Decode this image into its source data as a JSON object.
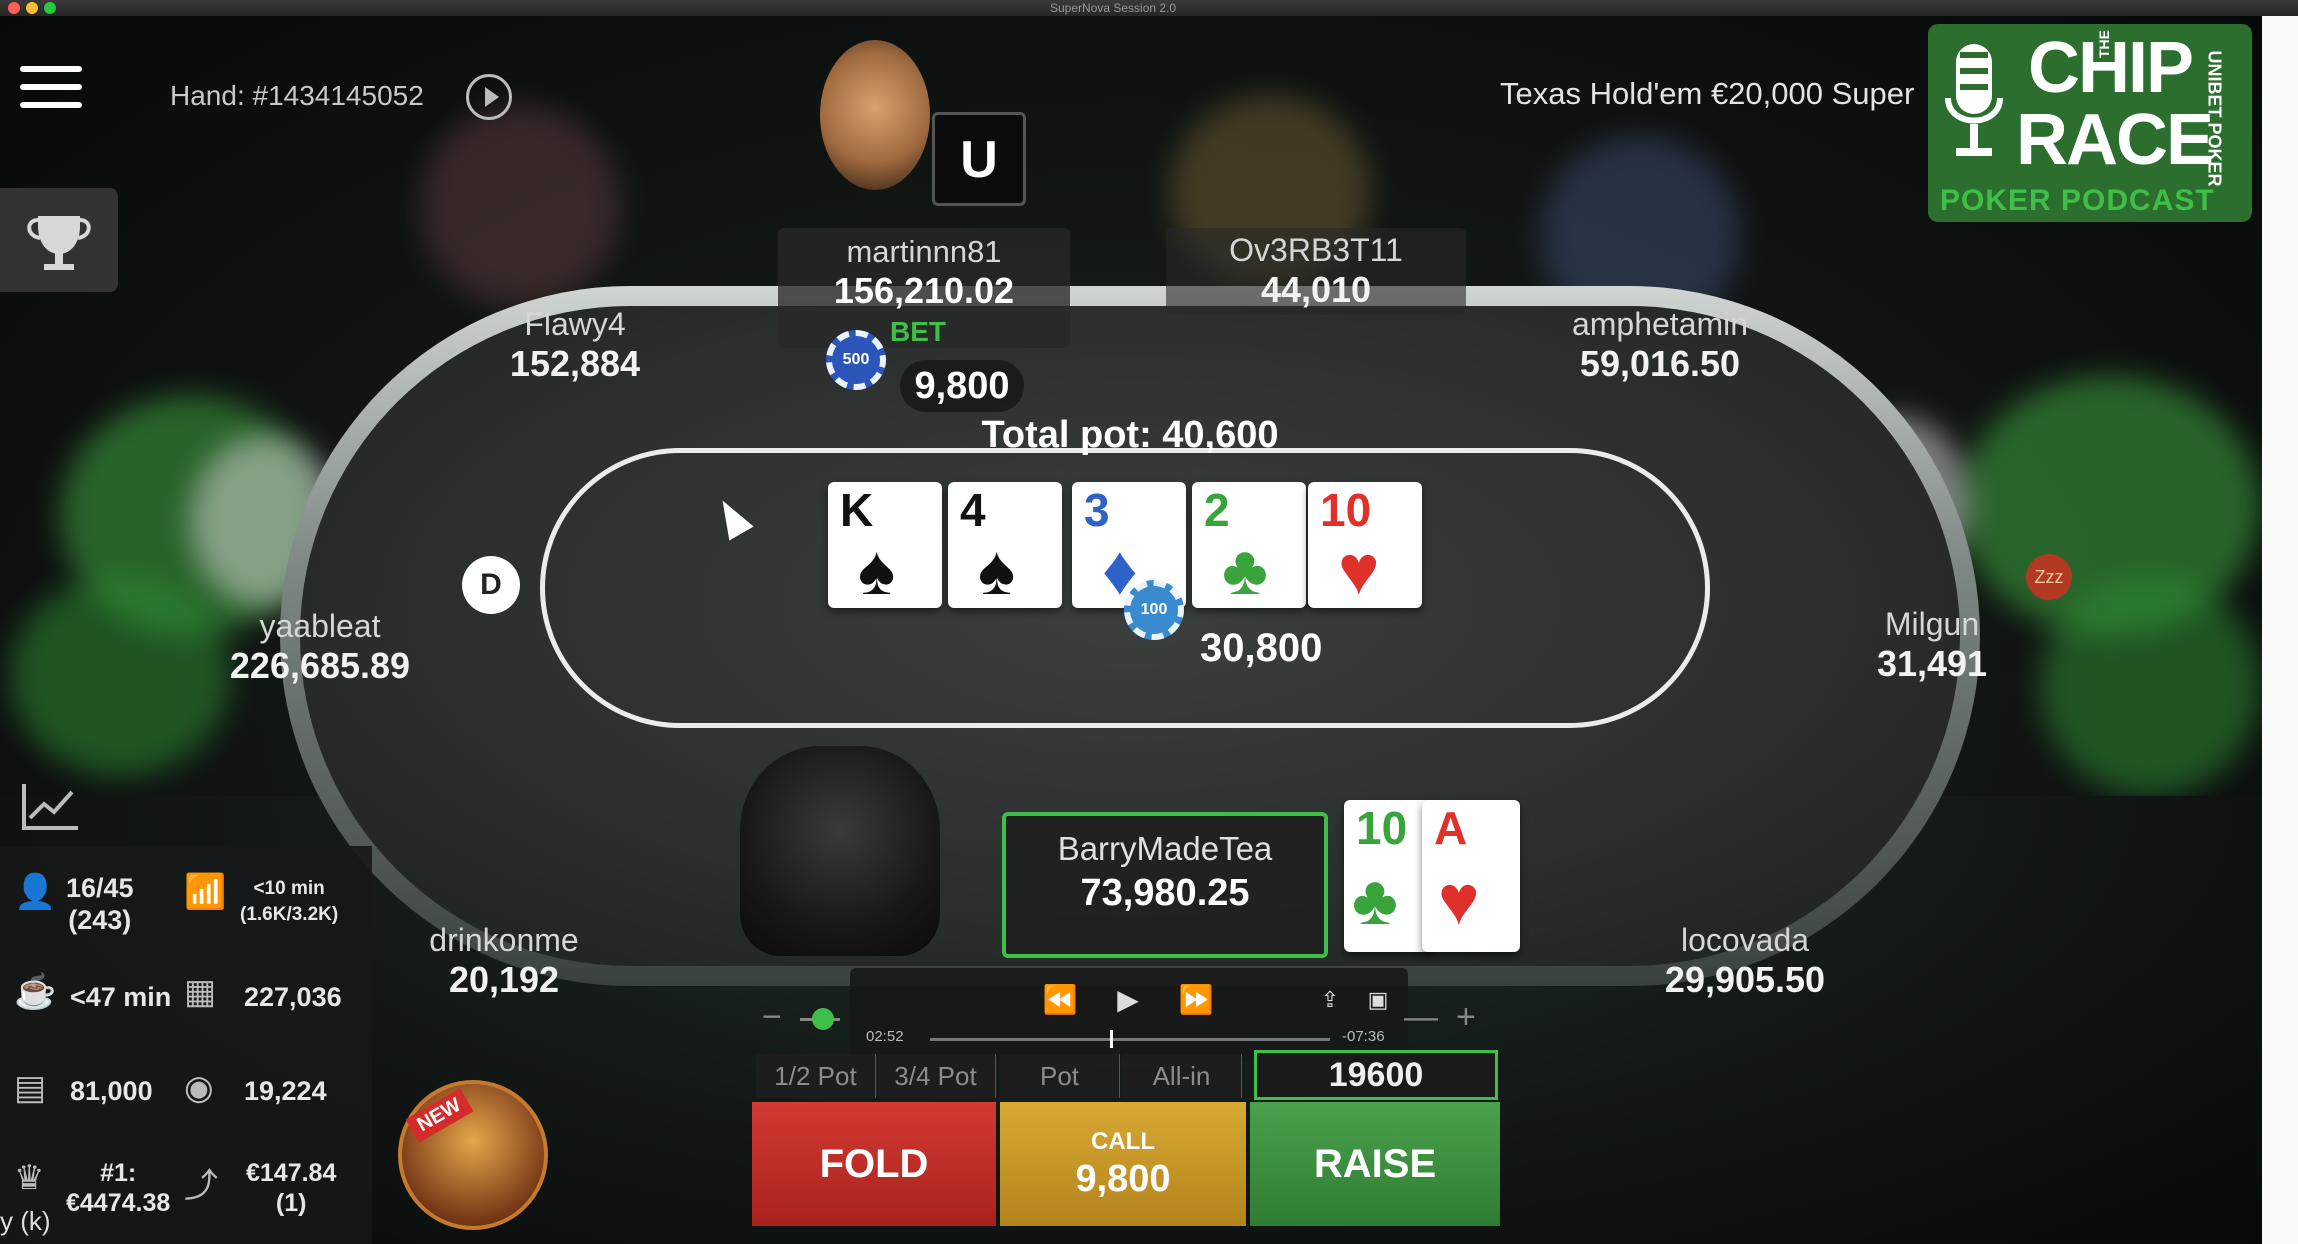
{
  "window": {
    "title": "SuperNova Session 2.0"
  },
  "header": {
    "hand_label": "Hand: #1434145052",
    "game_info": "Texas Hold'em   €20,000 Super"
  },
  "logo": {
    "the": "THE",
    "chip": "CHIP",
    "race": "RACE",
    "subtitle": "POKER PODCAST",
    "side": "UNIBET POKER"
  },
  "players": {
    "martinnn81": {
      "name": "martinnn81",
      "stack": "156,210.02",
      "bet_tag": "BET",
      "bet_amount": "9,800",
      "chip_label": "500"
    },
    "ov3rb3t11": {
      "name": "Ov3RB3T11",
      "stack": "44,010"
    },
    "flawy4": {
      "name": "Flawy4",
      "stack": "152,884"
    },
    "amphetamin": {
      "name": "amphetamin",
      "stack": "59,016.50"
    },
    "yaableat": {
      "name": "yaableat",
      "stack": "226,685.89"
    },
    "milgun": {
      "name": "Milgun",
      "stack": "31,491",
      "sleep_badge": "Zzz"
    },
    "drinkonme": {
      "name": "drinkonme",
      "stack": "20,192"
    },
    "locovada": {
      "name": "locovada",
      "stack": "29,905.50"
    },
    "hero": {
      "name": "BarryMadeTea",
      "stack": "73,980.25"
    }
  },
  "table": {
    "total_pot": "Total pot: 40,600",
    "pot_amount": "30,800",
    "pot_chip_label": "100",
    "dealer": "D",
    "board": [
      {
        "rank": "K",
        "suit": "♠",
        "suit_name": "spade"
      },
      {
        "rank": "4",
        "suit": "♠",
        "suit_name": "spade"
      },
      {
        "rank": "3",
        "suit": "♦",
        "suit_name": "diamond"
      },
      {
        "rank": "2",
        "suit": "♣",
        "suit_name": "club"
      },
      {
        "rank": "10",
        "suit": "♥",
        "suit_name": "heart"
      }
    ],
    "hole_cards": [
      {
        "rank": "10",
        "suit": "♣",
        "suit_name": "club"
      },
      {
        "rank": "A",
        "suit": "♥",
        "suit_name": "heart"
      }
    ]
  },
  "stats": {
    "position": "16/45",
    "position_sub": "(243)",
    "blinds_time": "<10 min",
    "blinds_level": "(1.6K/3.2K)",
    "break": "<47 min",
    "largest_stack": "227,036",
    "average_stack": "81,000",
    "smallest_stack": "19,224",
    "first_prize_label": "#1:",
    "first_prize": "€4474.38",
    "next_prize": "€147.84",
    "next_prize_sub": "(1)"
  },
  "promo": {
    "tag": "NEW"
  },
  "player_bar": {
    "elapsed": "02:52",
    "remaining": "-07:36",
    "progress": 0.45
  },
  "actions": {
    "presets": [
      "1/2 Pot",
      "3/4 Pot",
      "Pot",
      "All-in"
    ],
    "raise_value": "19600",
    "fold": "FOLD",
    "call_label": "CALL",
    "call_amount": "9,800",
    "raise": "RAISE"
  },
  "caption": "y (k)",
  "colors": {
    "accent_green": "#3fbf48",
    "fold_red": "#c2302a",
    "call_gold": "#c8962a",
    "raise_green": "#3d8f40"
  }
}
